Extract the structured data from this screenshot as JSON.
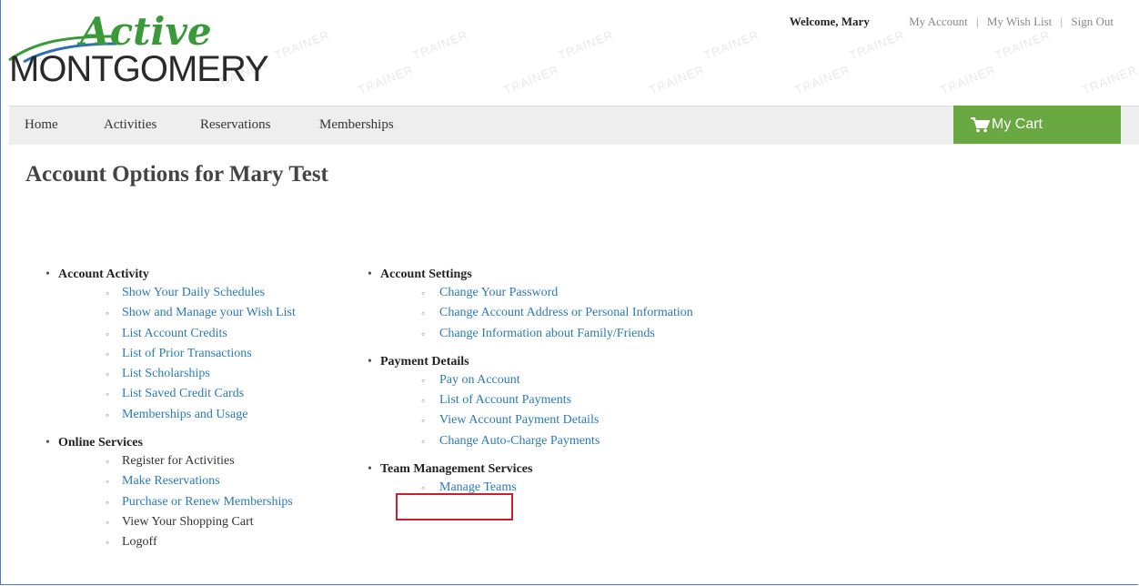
{
  "header": {
    "logo_script": "Active",
    "logo_word": "MONTGOMERY",
    "welcome": "Welcome, Mary",
    "links": [
      "My Account",
      "My Wish List",
      "Sign Out"
    ],
    "watermark_text": "TRAINER"
  },
  "nav": {
    "items": [
      "Home",
      "Activities",
      "Reservations",
      "Memberships"
    ],
    "cart_label": "My Cart"
  },
  "page_title": "Account Options for Mary Test",
  "left_groups": [
    {
      "title": "Account Activity",
      "links": [
        "Show Your Daily Schedules",
        "Show and Manage your Wish List",
        "List Account Credits",
        "List of Prior Transactions",
        "List Scholarships",
        "List Saved Credit Cards",
        "Memberships and Usage"
      ]
    },
    {
      "title": "Online Services",
      "links": [
        "Register for Activities",
        "Make Reservations",
        "Purchase or Renew Memberships",
        "View Your Shopping Cart",
        "Logoff"
      ]
    }
  ],
  "right_groups": [
    {
      "title": "Account Settings",
      "links": [
        "Change Your Password",
        "Change Account Address or Personal Information",
        "Change Information about Family/Friends"
      ]
    },
    {
      "title": "Payment Details",
      "links": [
        "Pay on Account",
        "List of Account Payments",
        "View Account Payment Details",
        "Change Auto-Charge Payments"
      ]
    },
    {
      "title": "Team Management Services",
      "links": [
        "Manage Teams"
      ]
    }
  ],
  "colors": {
    "link": "#2a7ab8",
    "cart_bg": "#6aa842",
    "highlight": "#c8202e"
  }
}
